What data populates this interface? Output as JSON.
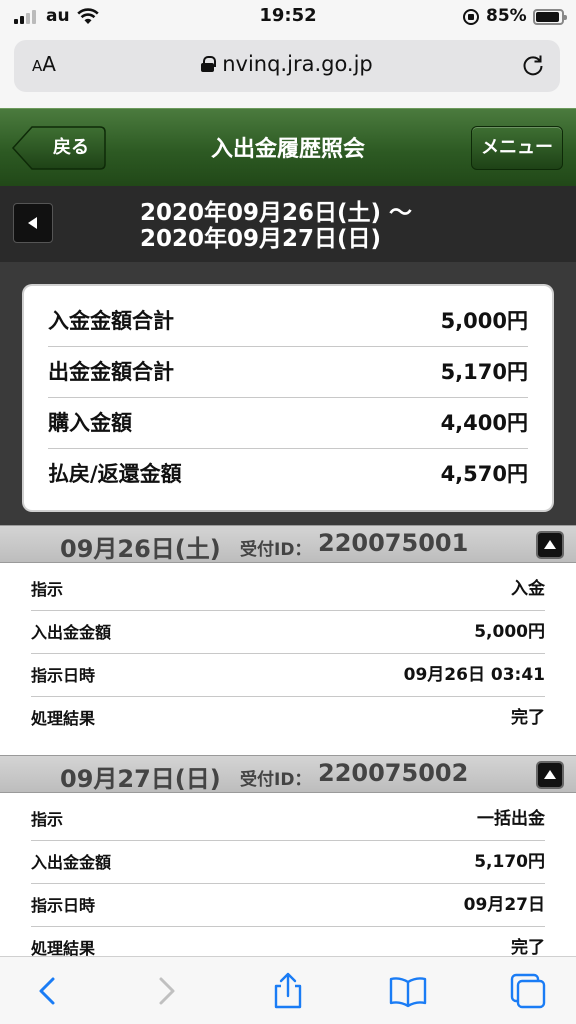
{
  "status_bar": {
    "carrier": "au",
    "time": "19:52",
    "battery": "85%"
  },
  "browser": {
    "aa_small": "A",
    "aa_large": "A",
    "url": "nvinq.jra.go.jp"
  },
  "header": {
    "back_label": "戻る",
    "title": "入出金履歴照会",
    "menu_label": "メニュー"
  },
  "date_range": {
    "line1": "2020年09月26日(土) 〜",
    "line2": "2020年09月27日(日)"
  },
  "summary": [
    {
      "label": "入金金額合計",
      "value": "5,000円"
    },
    {
      "label": "出金金額合計",
      "value": "5,170円"
    },
    {
      "label": "購入金額",
      "value": "4,400円"
    },
    {
      "label": "払戻/返還金額",
      "value": "4,570円"
    }
  ],
  "transactions": [
    {
      "date": "09月26日(土)",
      "id_label": "受付ID：",
      "id": "220075001",
      "rows": [
        {
          "label": "指示",
          "value": "入金"
        },
        {
          "label": "入出金金額",
          "value": "5,000円"
        },
        {
          "label": "指示日時",
          "value": "09月26日 03:41"
        },
        {
          "label": "処理結果",
          "value": "完了"
        }
      ]
    },
    {
      "date": "09月27日(日)",
      "id_label": "受付ID：",
      "id": "220075002",
      "rows": [
        {
          "label": "指示",
          "value": "一括出金"
        },
        {
          "label": "入出金金額",
          "value": "5,170円"
        },
        {
          "label": "指示日時",
          "value": "09月27日"
        },
        {
          "label": "処理結果",
          "value": "完了"
        }
      ]
    }
  ],
  "colors": {
    "header_green": "#2d5a23",
    "dark_bg": "#3a3a3a",
    "ios_blue": "#1a7cf5"
  },
  "toolbar_icons": [
    "back-arrow-icon",
    "forward-arrow-icon",
    "share-icon",
    "bookmarks-icon",
    "tabs-icon"
  ]
}
